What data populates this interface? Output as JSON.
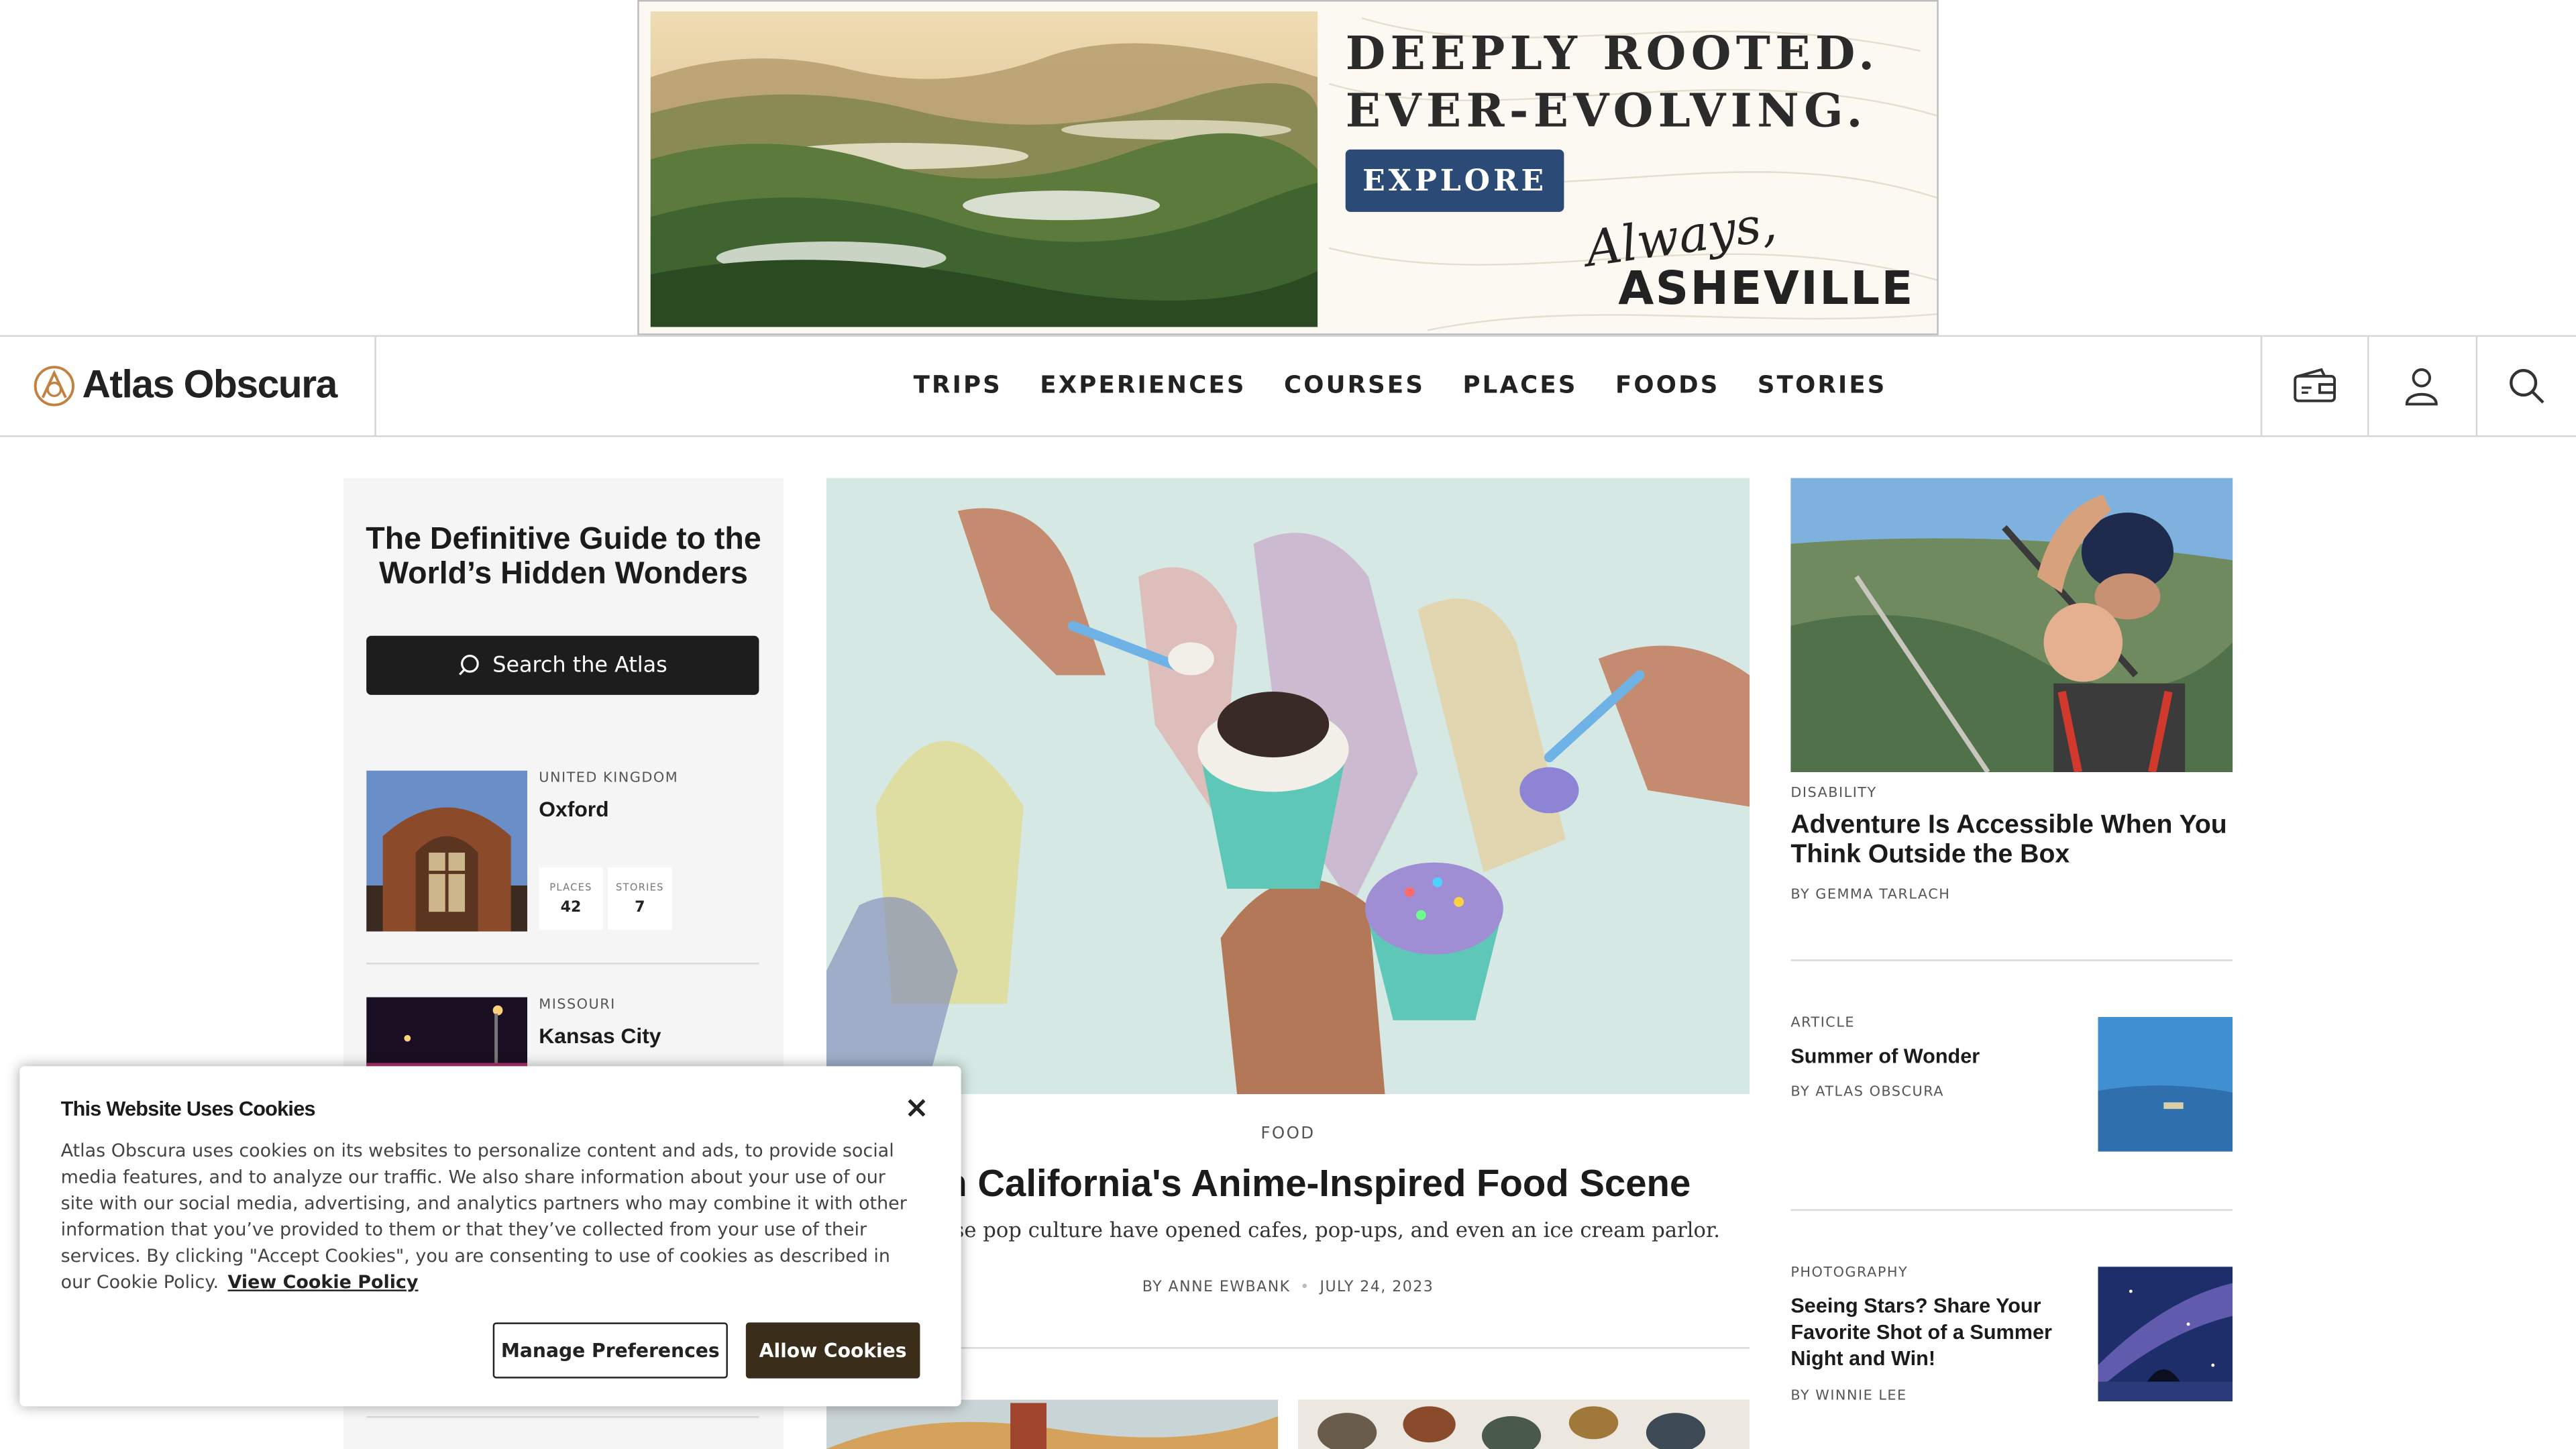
{
  "ad": {
    "headline_line1": "DEEPLY ROOTED.",
    "headline_line2": "EVER-EVOLVING.",
    "cta": "EXPLORE",
    "brand_script": "Always,",
    "brand_name": "ASHEVILLE"
  },
  "nav": {
    "logo_text": "Atlas Obscura",
    "links": [
      "TRIPS",
      "EXPERIENCES",
      "COURSES",
      "PLACES",
      "FOODS",
      "STORIES"
    ],
    "icons": [
      "wallet-icon",
      "user-icon",
      "search-icon"
    ]
  },
  "left": {
    "guide_title": "The Definitive Guide to the World’s Hidden Wonders",
    "search_label": "Search the Atlas",
    "destinations": [
      {
        "country": "UNITED KINGDOM",
        "name": "Oxford",
        "places_label": "PLACES",
        "places": "42",
        "stories_label": "STORIES",
        "stories": "7"
      },
      {
        "country": "MISSOURI",
        "name": "Kansas City"
      }
    ]
  },
  "hero": {
    "tag": "FOOD",
    "title": "hern California's Anime-Inspired Food Scene",
    "dek": "of Japanese pop culture have opened cafes, pop-ups, and even an ice cream parlor.",
    "byline": "BY ANNE EWBANK",
    "date": "JULY 24, 2023"
  },
  "right": {
    "featured": {
      "tag": "DISABILITY",
      "title": "Adventure Is Accessible When You Think Outside the Box",
      "byline": "BY GEMMA TARLACH"
    },
    "items": [
      {
        "tag": "ARTICLE",
        "title": "Summer of Wonder",
        "byline": "BY ATLAS OBSCURA"
      },
      {
        "tag": "PHOTOGRAPHY",
        "title": "Seeing Stars? Share Your Favorite Shot of a Summer Night and Win!",
        "byline": "BY WINNIE LEE"
      }
    ]
  },
  "cookie": {
    "title": "This Website Uses Cookies",
    "body": "Atlas Obscura uses cookies on its websites to personalize content and ads, to provide social media features, and to analyze our traffic. We also share information about your use of our site with our social media, advertising, and analytics partners who may combine it with other information that you’ve provided to them or that they’ve collected from your use of their services. By clicking \"Accept Cookies\", you are consenting to use of cookies as described in our Cookie Policy.",
    "link": "View Cookie Policy",
    "manage_label": "Manage Preferences",
    "allow_label": "Allow Cookies",
    "close_glyph": "×"
  },
  "colors": {
    "explore_button": "#2b4a75",
    "allow_button": "#3a2d19",
    "logo_accent": "#c2813f",
    "search_button": "#1d1d1d"
  }
}
